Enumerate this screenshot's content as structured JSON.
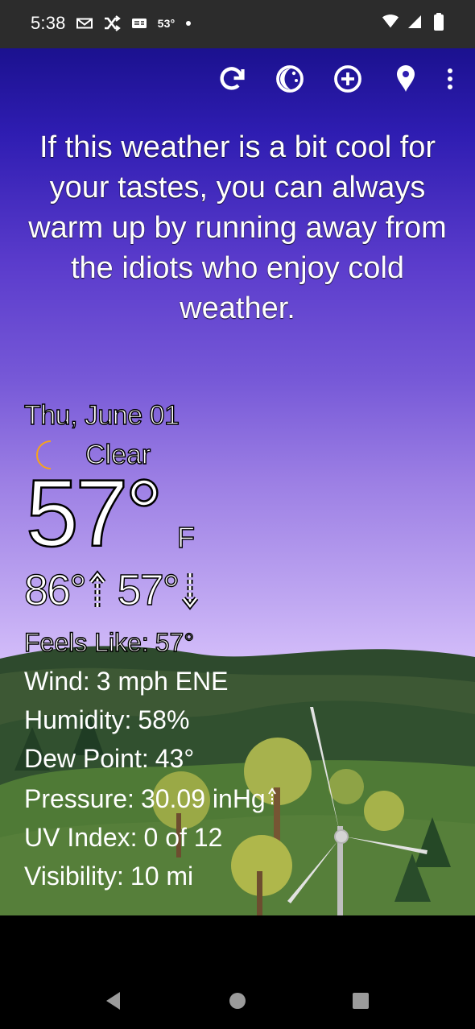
{
  "status_bar": {
    "time": "5:38",
    "notification_icons": [
      "mail-icon",
      "shuffle-icon",
      "news-icon"
    ],
    "weather_temperature": "53°",
    "signal_icons": [
      "wifi-icon",
      "cellular-signal-icon",
      "battery-icon"
    ]
  },
  "toolbar": {
    "actions": [
      {
        "name": "refresh-button",
        "icon": "refresh-icon"
      },
      {
        "name": "night-mode-button",
        "icon": "moon-toggle-icon"
      },
      {
        "name": "add-location-button",
        "icon": "plus-circle-icon"
      },
      {
        "name": "location-button",
        "icon": "map-pin-icon"
      },
      {
        "name": "more-menu-button",
        "icon": "more-vertical-icon"
      }
    ]
  },
  "message": "If this weather is a bit cool for your tastes, you can always warm up by running away from the idiots who enjoy cold weather.",
  "weather": {
    "date": "Thu, June 01",
    "condition": "Clear",
    "condition_icon": "crescent-moon-icon",
    "temperature": "57°",
    "unit": "F",
    "high": "86°",
    "low": "57°",
    "details": {
      "feels_like_label": "Feels Like:",
      "feels_like_value": "57°",
      "wind_label": "Wind:",
      "wind_value": "3 mph ENE",
      "humidity_label": "Humidity:",
      "humidity_value": "58%",
      "dew_point_label": "Dew Point:",
      "dew_point_value": "43°",
      "pressure_label": "Pressure:",
      "pressure_value": "30.09 inHg",
      "pressure_trend_icon": "rising-arrow-icon",
      "uv_label": "UV Index:",
      "uv_value": "0 of 12",
      "visibility_label": "Visibility:",
      "visibility_value": "10 mi"
    }
  },
  "navigation": {
    "buttons": [
      "back-icon",
      "home-icon",
      "recents-icon"
    ]
  },
  "colors": {
    "status_bar": "#2c2c2c",
    "sky_top": "#1b118f",
    "sky_mid": "#9c7fe4",
    "sky_horizon": "#d7c1fb",
    "text": "#ffffff",
    "text_outline": "#000000",
    "moon": "#3655d9",
    "hill": "#304c2d",
    "turbine": "#c8c8c8",
    "navigation_bar": "#000000"
  }
}
